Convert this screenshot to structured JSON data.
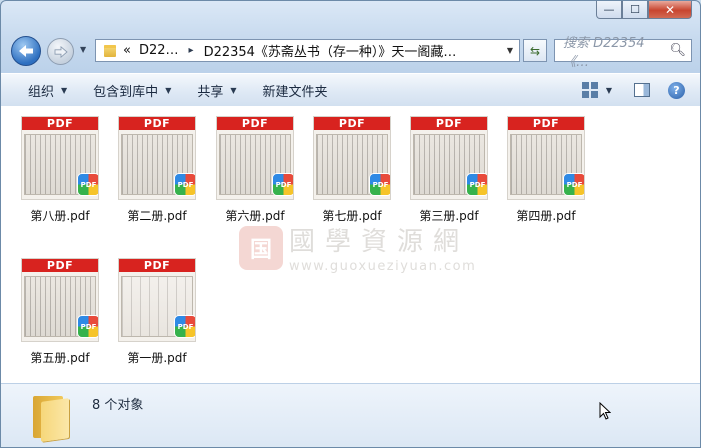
{
  "window": {
    "caption_buttons": {
      "minimize": "—",
      "maximize": "☐",
      "close": "✕"
    }
  },
  "nav": {
    "back_icon": "back-arrow-icon",
    "forward_icon": "forward-arrow-icon"
  },
  "address": {
    "overflow": "«",
    "crumb1": "D22…",
    "crumb2": "D22354《苏斋丛书（存一种）》天一阁藏…",
    "separator": "▸"
  },
  "search": {
    "placeholder": "搜索 D22354《…"
  },
  "toolbar": {
    "organize": "组织",
    "include_in_library": "包含到库中",
    "share": "共享",
    "new_folder": "新建文件夹"
  },
  "files": [
    {
      "name": "第八册.pdf",
      "band": "PDF",
      "badge": "PDF"
    },
    {
      "name": "第二册.pdf",
      "band": "PDF",
      "badge": "PDF"
    },
    {
      "name": "第六册.pdf",
      "band": "PDF",
      "badge": "PDF"
    },
    {
      "name": "第七册.pdf",
      "band": "PDF",
      "badge": "PDF"
    },
    {
      "name": "第三册.pdf",
      "band": "PDF",
      "badge": "PDF"
    },
    {
      "name": "第四册.pdf",
      "band": "PDF",
      "badge": "PDF"
    },
    {
      "name": "第五册.pdf",
      "band": "PDF",
      "badge": "PDF"
    },
    {
      "name": "第一册.pdf",
      "band": "PDF",
      "badge": "PDF"
    }
  ],
  "watermark": {
    "seal": "国",
    "text": "國學資源網",
    "url": "www.guoxueziyuan.com"
  },
  "status": {
    "count": "8 个对象"
  },
  "colors": {
    "pdf_red": "#d8231f",
    "toolbar_bg": "#dfe9f5"
  }
}
